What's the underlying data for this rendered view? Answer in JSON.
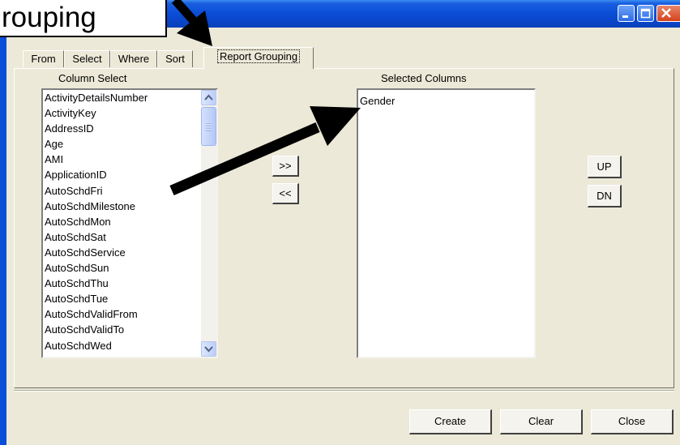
{
  "callout": {
    "text": "rouping"
  },
  "tabs": [
    "From",
    "Select",
    "Where",
    "Sort",
    "Report Grouping"
  ],
  "column_select": {
    "label": "Column Select",
    "items": [
      "ActivityDetailsNumber",
      "ActivityKey",
      "AddressID",
      "Age",
      "AMI",
      "ApplicationID",
      "AutoSchdFri",
      "AutoSchdMilestone",
      "AutoSchdMon",
      "AutoSchdSat",
      "AutoSchdService",
      "AutoSchdSun",
      "AutoSchdThu",
      "AutoSchdTue",
      "AutoSchdValidFrom",
      "AutoSchdValidTo",
      "AutoSchdWed"
    ]
  },
  "transfer": {
    "add_label": ">>",
    "remove_label": "<<"
  },
  "selected_columns": {
    "label": "Selected Columns",
    "items": [
      "Gender"
    ]
  },
  "order": {
    "up_label": "UP",
    "down_label": "DN"
  },
  "footer": {
    "create_label": "Create",
    "clear_label": "Clear",
    "close_label": "Close"
  }
}
